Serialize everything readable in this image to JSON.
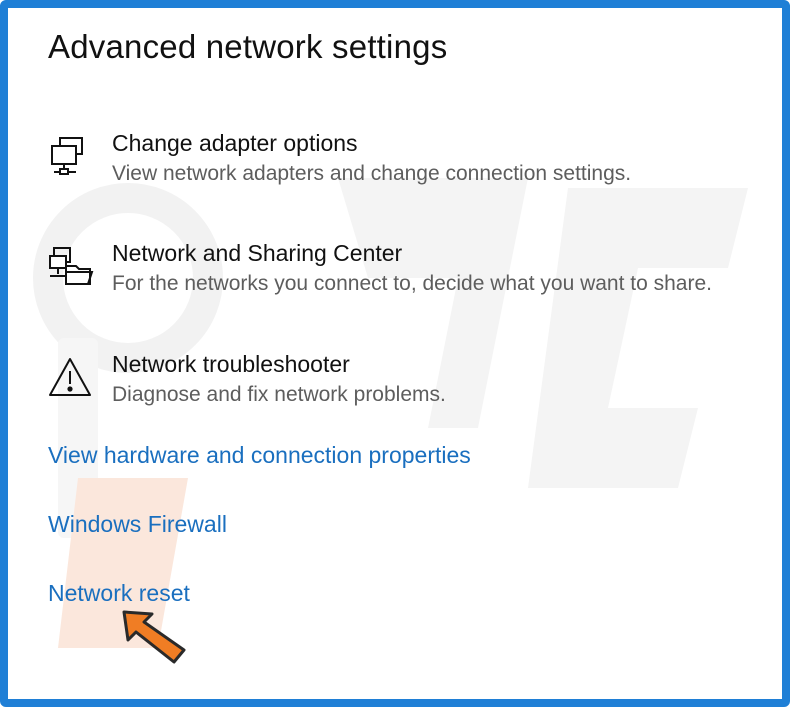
{
  "header": {
    "title": "Advanced network settings"
  },
  "options": [
    {
      "icon": "network-adapter-icon",
      "title": "Change adapter options",
      "description": "View network adapters and change connection settings."
    },
    {
      "icon": "network-sharing-icon",
      "title": "Network and Sharing Center",
      "description": "For the networks you connect to, decide what you want to share."
    },
    {
      "icon": "warning-icon",
      "title": "Network troubleshooter",
      "description": "Diagnose and fix network problems."
    }
  ],
  "links": [
    {
      "label": "View hardware and connection properties"
    },
    {
      "label": "Windows Firewall"
    },
    {
      "label": "Network reset"
    }
  ],
  "colors": {
    "frame_border": "#1f7fd6",
    "link": "#1a6fbf",
    "pointer_arrow": "#f07d24"
  }
}
